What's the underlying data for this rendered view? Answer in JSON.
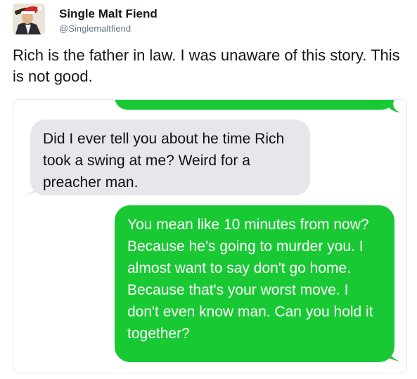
{
  "tweet": {
    "user": {
      "name": "Single Malt Fiend",
      "handle": "@Singlemaltfiend",
      "avatar_icon": "man-drinking-with-santa-hat"
    },
    "text": "Rich is the father in law. I was unaware of this story. This is not good."
  },
  "conversation": {
    "messages": [
      {
        "direction": "sent",
        "text": ""
      },
      {
        "direction": "received",
        "text": "Did I ever tell you about he time Rich took a swing at me? Weird for a preacher man."
      },
      {
        "direction": "sent",
        "text": "You mean like 10 minutes from now? Because he's going to murder you. I almost want to say don't go home. Because that's your worst move. I don't even know man. Can you hold it together?"
      }
    ]
  },
  "colors": {
    "sent_bubble": "#19c934",
    "received_bubble": "#e6e6eb",
    "handle_gray": "#657786"
  }
}
